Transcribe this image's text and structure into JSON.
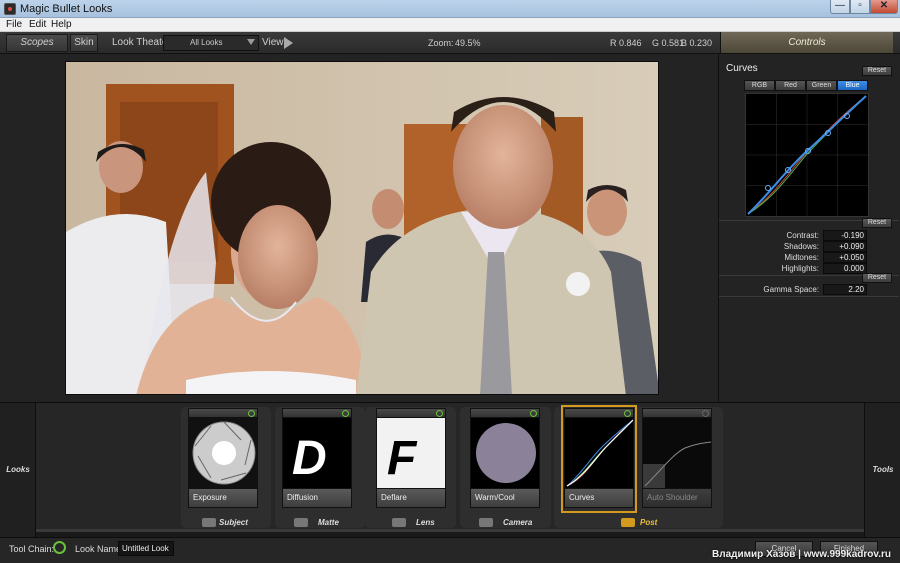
{
  "window": {
    "title": "Magic Bullet Looks",
    "minimize_label": "—",
    "maximize_label": "▫",
    "close_label": "✕"
  },
  "menu": [
    "File",
    "Edit",
    "Help"
  ],
  "toolbar": {
    "scopes_label": "Scopes",
    "skin_label": "Skin",
    "look_theater_label": "Look Theater",
    "theater_selected": "All Looks",
    "view_label": "View",
    "zoom_label": "Zoom:",
    "zoom_value": "49.5%",
    "r_value": "R 0.846",
    "g_value": "G 0.581",
    "b_value": "B 0.230",
    "controls_label": "Controls"
  },
  "controls": {
    "section_title": "Curves",
    "reset_label": "Reset",
    "channels": [
      "RGB",
      "Red",
      "Green",
      "Blue"
    ],
    "active_channel": "Blue",
    "params": [
      {
        "label": "Contrast:",
        "value": "-0.190"
      },
      {
        "label": "Shadows:",
        "value": "+0.090"
      },
      {
        "label": "Midtones:",
        "value": "+0.050"
      },
      {
        "label": "Highlights:",
        "value": "0.000"
      }
    ],
    "gamma_label": "Gamma Space:",
    "gamma_value": "2.20"
  },
  "looks_strip": {
    "looks_label": "Looks",
    "tools_label": "Tools",
    "tiles": [
      {
        "name": "Exposure",
        "enabled": true
      },
      {
        "name": "Diffusion",
        "enabled": true
      },
      {
        "name": "Deflare",
        "enabled": true
      },
      {
        "name": "Warm/Cool",
        "enabled": true
      },
      {
        "name": "Curves",
        "enabled": true
      },
      {
        "name": "Auto Shoulder",
        "enabled": false
      }
    ],
    "categories": [
      "Subject",
      "Matte",
      "Lens",
      "Camera",
      "Post"
    ],
    "diffusion_letter": "D",
    "deflare_letter": "F"
  },
  "footer": {
    "toolchain_label": "Tool Chain:",
    "lookname_label": "Look Name:",
    "lookname_value": "Untitled Look",
    "cancel_label": "Cancel",
    "finished_label": "Finished",
    "watermark": "Владимир Хазов | www.999kadrov.ru"
  },
  "colors": {
    "accent": "#d39a1d",
    "active_channel": "#1e67c2",
    "power_on": "#6bc23a"
  }
}
